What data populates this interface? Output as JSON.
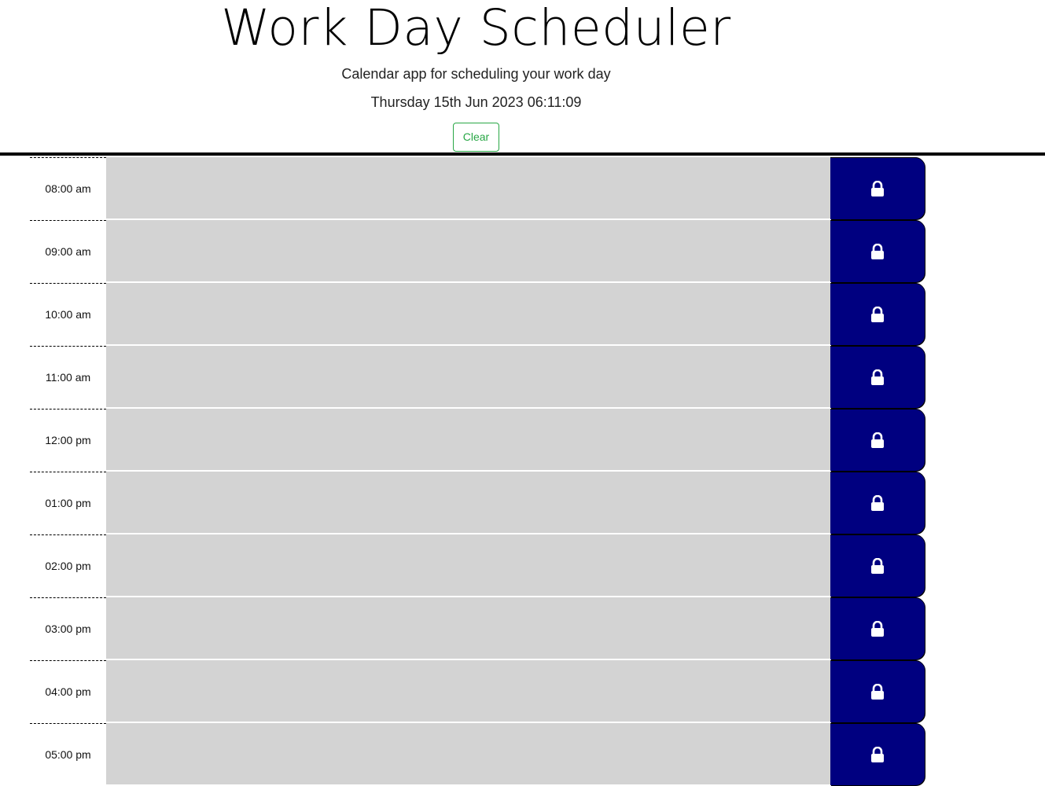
{
  "header": {
    "title": "Work Day Scheduler",
    "subtitle": "Calendar app for scheduling your work day",
    "datetime": "Thursday 15th Jun 2023 06:11:09",
    "clear_label": "Clear"
  },
  "colors": {
    "past_block": "#d3d3d3",
    "save_button": "#000080",
    "clear_accent": "#28a745"
  },
  "slots": [
    {
      "hour": "08:00 am",
      "text": "",
      "icon": "lock-icon"
    },
    {
      "hour": "09:00 am",
      "text": "",
      "icon": "lock-icon"
    },
    {
      "hour": "10:00 am",
      "text": "",
      "icon": "lock-icon"
    },
    {
      "hour": "11:00 am",
      "text": "",
      "icon": "lock-icon"
    },
    {
      "hour": "12:00 pm",
      "text": "",
      "icon": "lock-icon"
    },
    {
      "hour": "01:00 pm",
      "text": "",
      "icon": "lock-icon"
    },
    {
      "hour": "02:00 pm",
      "text": "",
      "icon": "lock-icon"
    },
    {
      "hour": "03:00 pm",
      "text": "",
      "icon": "lock-icon"
    },
    {
      "hour": "04:00 pm",
      "text": "",
      "icon": "lock-icon"
    },
    {
      "hour": "05:00 pm",
      "text": "",
      "icon": "lock-icon"
    }
  ]
}
